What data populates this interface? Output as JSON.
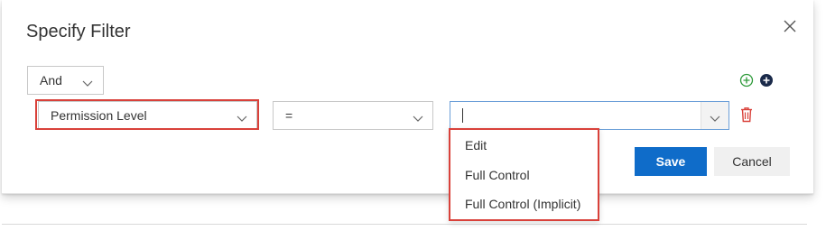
{
  "dialog": {
    "title": "Specify Filter"
  },
  "filter": {
    "logic": "And",
    "field": "Permission Level",
    "operator": "=",
    "value": ""
  },
  "dropdown": {
    "options": [
      "Edit",
      "Full Control",
      "Full Control (Implicit)"
    ]
  },
  "buttons": {
    "save": "Save",
    "cancel": "Cancel"
  },
  "colors": {
    "accent": "#0f6cc9",
    "highlight": "#d9413a",
    "add_icon": "#2e9a3a",
    "add_solid_icon": "#1a2a4a",
    "delete_icon": "#d9413a"
  },
  "icons": [
    "close-icon",
    "add-circle-icon",
    "add-circle-filled-icon",
    "delete-icon",
    "chevron-down-icon"
  ]
}
